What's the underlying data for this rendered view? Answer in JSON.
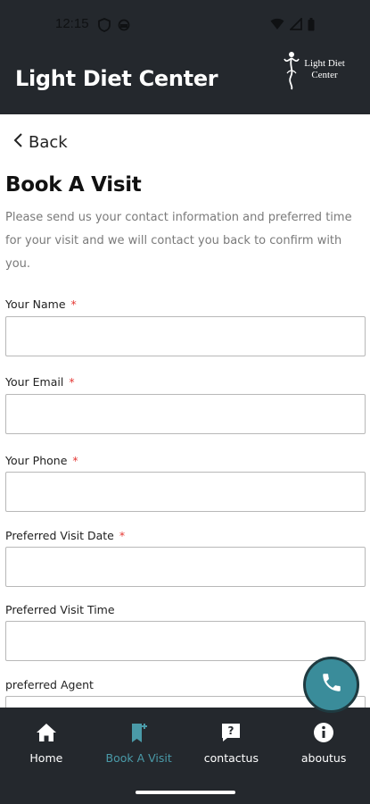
{
  "status_bar": {
    "time": "12:15"
  },
  "header": {
    "title": "Light Diet Center",
    "logo_text": "Light Diet Center"
  },
  "back": {
    "label": "Back"
  },
  "page": {
    "title": "Book A Visit",
    "intro": "Please send us your contact information and preferred time for your visit and we will contact you back to confirm with you."
  },
  "form": {
    "fields": [
      {
        "label": "Your Name",
        "required_mark": "*",
        "value": ""
      },
      {
        "label": "Your Email",
        "required_mark": "*",
        "value": ""
      },
      {
        "label": "Your Phone",
        "required_mark": "*",
        "value": ""
      },
      {
        "label": "Preferred Visit Date",
        "required_mark": "*",
        "value": ""
      },
      {
        "label": "Preferred Visit Time",
        "value": ""
      },
      {
        "label": "preferred Agent",
        "value": ""
      }
    ]
  },
  "fab": {
    "icon": "phone-icon"
  },
  "bottom_nav": {
    "items": [
      {
        "label": "Home",
        "icon": "home-icon"
      },
      {
        "label": "Book A Visit",
        "icon": "bookmark-add-icon",
        "active": true
      },
      {
        "label": "contactus",
        "icon": "question-chat-icon"
      },
      {
        "label": "aboutus",
        "icon": "info-icon"
      }
    ]
  },
  "colors": {
    "bar_bg": "#24282d",
    "accent": "#4a9aa8",
    "fab": "#3a8c9a",
    "required": "#e53935"
  }
}
